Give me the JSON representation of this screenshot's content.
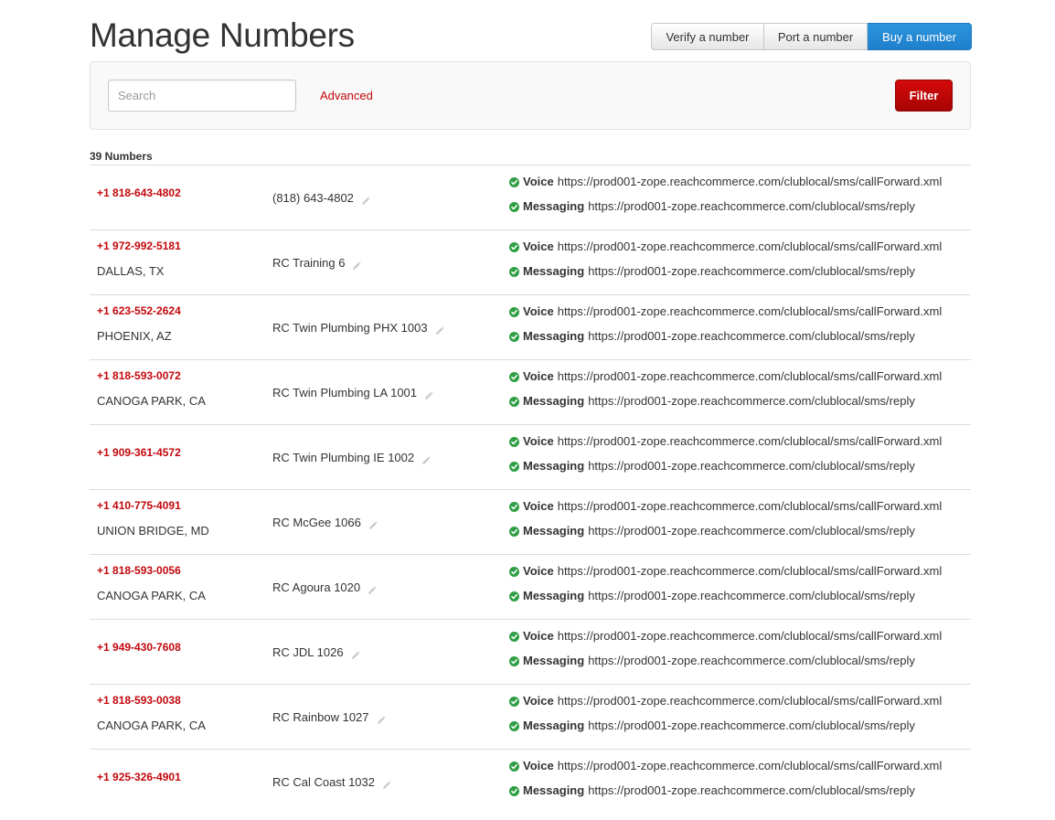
{
  "page": {
    "title": "Manage Numbers"
  },
  "actions": {
    "verify_label": "Verify a number",
    "port_label": "Port a number",
    "buy_label": "Buy a number"
  },
  "filter": {
    "search_placeholder": "Search",
    "advanced_label": "Advanced",
    "filter_label": "Filter"
  },
  "colors": {
    "accent_red": "#c2070c",
    "primary_blue": "#2c8ad8",
    "success_green": "#2f9e44"
  },
  "list": {
    "count_label": "39 Numbers",
    "voice_label": "Voice",
    "messaging_label": "Messaging",
    "voice_url": "https://prod001-zope.reachcommerce.com/clublocal/sms/callForward.xml",
    "messaging_url": "https://prod001-zope.reachcommerce.com/clublocal/sms/reply",
    "rows": [
      {
        "phone": "+1 818-643-4802",
        "location": "",
        "friendly": "(818) 643-4802"
      },
      {
        "phone": "+1 972-992-5181",
        "location": "DALLAS, TX",
        "friendly": "RC Training 6"
      },
      {
        "phone": "+1 623-552-2624",
        "location": "PHOENIX, AZ",
        "friendly": "RC Twin Plumbing PHX 1003"
      },
      {
        "phone": "+1 818-593-0072",
        "location": "CANOGA PARK, CA",
        "friendly": "RC Twin Plumbing LA 1001"
      },
      {
        "phone": "+1 909-361-4572",
        "location": "",
        "friendly": "RC Twin Plumbing IE 1002"
      },
      {
        "phone": "+1 410-775-4091",
        "location": "UNION BRIDGE, MD",
        "friendly": "RC McGee 1066"
      },
      {
        "phone": "+1 818-593-0056",
        "location": "CANOGA PARK, CA",
        "friendly": "RC Agoura 1020"
      },
      {
        "phone": "+1 949-430-7608",
        "location": "",
        "friendly": "RC JDL 1026"
      },
      {
        "phone": "+1 818-593-0038",
        "location": "CANOGA PARK, CA",
        "friendly": "RC Rainbow 1027"
      },
      {
        "phone": "+1 925-326-4901",
        "location": "",
        "friendly": "RC Cal Coast 1032"
      }
    ]
  }
}
